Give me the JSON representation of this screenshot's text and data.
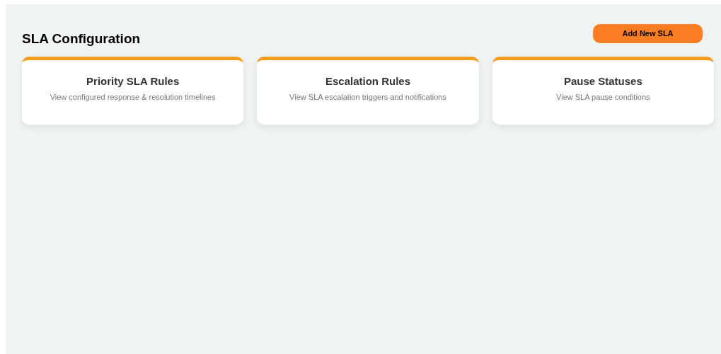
{
  "title": "SLA Configuration",
  "add_button": "Add New SLA",
  "cards": [
    {
      "title": "Priority SLA Rules",
      "description": "View configured response & resolution timelines"
    },
    {
      "title": "Escalation Rules",
      "description": "View SLA escalation triggers and notifications"
    },
    {
      "title": "Pause Statuses",
      "description": "View SLA pause conditions"
    }
  ]
}
